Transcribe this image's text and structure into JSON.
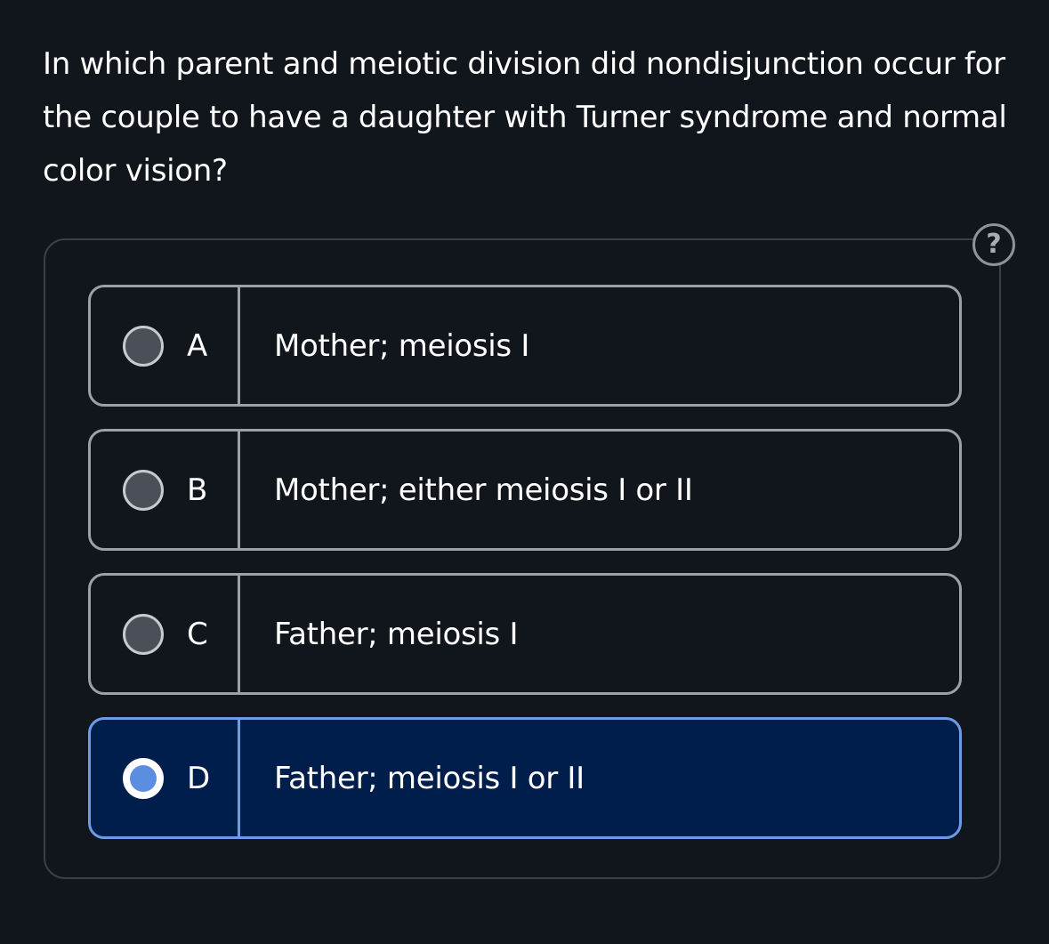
{
  "question": {
    "text": "In which parent and meiotic division did nondisjunction occur for the couple to have a daughter with Turner syndrome and normal color vision?"
  },
  "help": {
    "icon": "question-mark-icon",
    "label": "?"
  },
  "options": [
    {
      "letter": "A",
      "text": "Mother; meiosis I",
      "selected": false
    },
    {
      "letter": "B",
      "text": "Mother; either meiosis I or II",
      "selected": false
    },
    {
      "letter": "C",
      "text": "Father; meiosis I",
      "selected": false
    },
    {
      "letter": "D",
      "text": "Father; meiosis I or II",
      "selected": true
    }
  ],
  "colors": {
    "background": "#11151c",
    "selected_background": "#001e4c",
    "selected_border": "#6c9ce6",
    "radio_fill": "#5b8ee0"
  }
}
